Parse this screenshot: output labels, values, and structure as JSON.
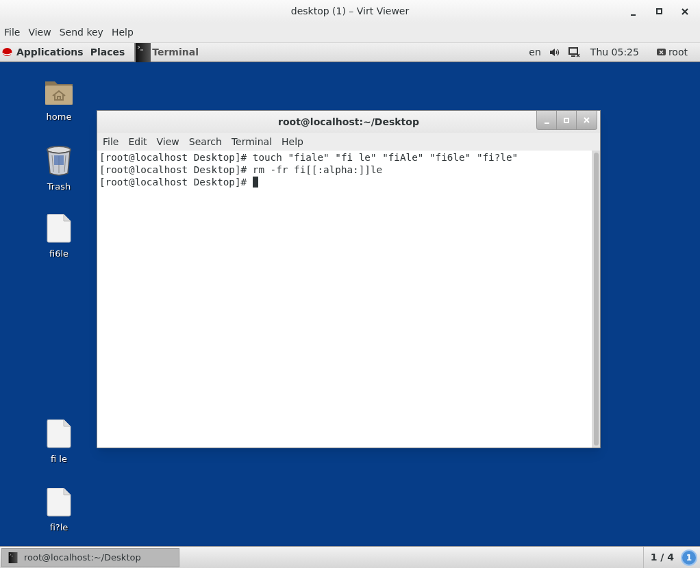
{
  "window": {
    "title": "desktop (1) – Virt Viewer"
  },
  "menu": [
    "File",
    "View",
    "Send key",
    "Help"
  ],
  "top_panel": {
    "left": [
      {
        "kind": "apps",
        "label": "Applications"
      },
      {
        "kind": "places",
        "label": "Places"
      },
      {
        "kind": "task",
        "label": "Terminal"
      }
    ],
    "language": "en",
    "clock": "Thu 05:25",
    "user": "root"
  },
  "desktop_icons": [
    {
      "kind": "folder",
      "label": "home"
    },
    {
      "kind": "trash",
      "label": "Trash"
    },
    {
      "kind": "file",
      "label": "fi6le"
    },
    {
      "kind": "file",
      "label": "fi le"
    },
    {
      "kind": "file",
      "label": "fi?le"
    }
  ],
  "terminal": {
    "title": "root@localhost:~/Desktop",
    "menu": [
      "File",
      "Edit",
      "View",
      "Search",
      "Terminal",
      "Help"
    ],
    "lines": [
      "[root@localhost Desktop]# touch \"fiale\" \"fi le\" \"fiAle\" \"fi6le\" \"fi?le\"",
      "[root@localhost Desktop]# rm -fr fi[[:alpha:]]le",
      "[root@localhost Desktop]# "
    ],
    "cursor_visible": true
  },
  "bottom_panel": {
    "task": "root@localhost:~/Desktop",
    "workspace": "1 / 4",
    "notifications": "1"
  }
}
